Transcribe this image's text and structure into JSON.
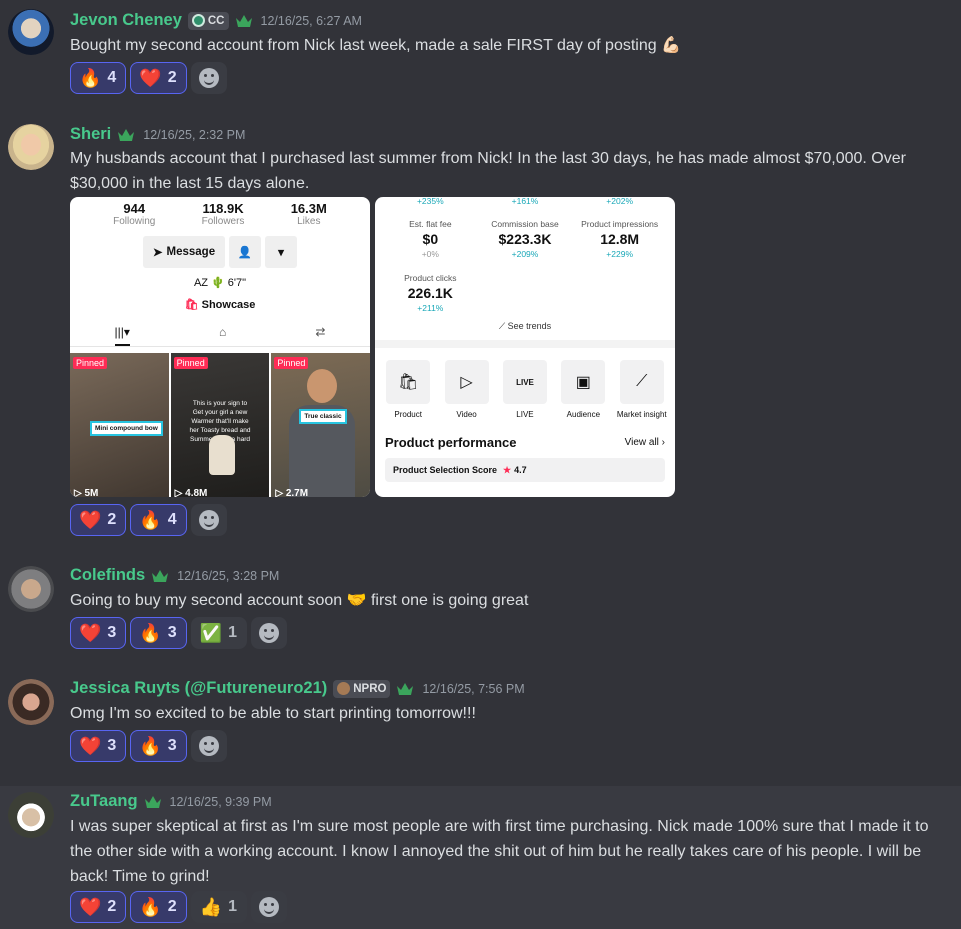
{
  "messages": [
    {
      "username": "Jevon Cheney",
      "tag": "CC",
      "timestamp": "12/16/25, 6:27 AM",
      "text": "Bought my second account from Nick last week, made a sale FIRST day of posting 💪🏻",
      "reactions": [
        {
          "emoji": "🔥",
          "count": "4",
          "mine": true
        },
        {
          "emoji": "❤️",
          "count": "2",
          "mine": true
        }
      ]
    },
    {
      "username": "Sheri",
      "timestamp": "12/16/25, 2:32 PM",
      "text": "My husbands account that I purchased last summer from Nick! In the last 30 days, he has made almost $70,000. Over $30,000 in the last 15 days alone.",
      "reactions": [
        {
          "emoji": "❤️",
          "count": "2",
          "mine": true
        },
        {
          "emoji": "🔥",
          "count": "4",
          "mine": true
        }
      ]
    },
    {
      "username": "Colefinds",
      "timestamp": "12/16/25, 3:28 PM",
      "text": "Going to buy my second account soon 🤝 first one is going great",
      "reactions": [
        {
          "emoji": "❤️",
          "count": "3",
          "mine": true
        },
        {
          "emoji": "🔥",
          "count": "3",
          "mine": true
        },
        {
          "emoji": "✅",
          "count": "1",
          "mine": false
        }
      ]
    },
    {
      "username": "Jessica Ruyts (@Futureneuro21)",
      "tag": "NPRO",
      "timestamp": "12/16/25, 7:56 PM",
      "text": "Omg I'm so excited to be able to start printing tomorrow!!!",
      "reactions": [
        {
          "emoji": "❤️",
          "count": "3",
          "mine": true
        },
        {
          "emoji": "🔥",
          "count": "3",
          "mine": true
        }
      ]
    },
    {
      "username": "ZuTaang",
      "timestamp": "12/16/25, 9:39 PM",
      "text": "I was super skeptical at first as I'm sure most people are with first time purchasing. Nick made 100% sure that I made it to the other side with a working account. I know I annoyed the shit out of him but he really takes care of his people. I will be back! Time to grind!",
      "reactions": [
        {
          "emoji": "❤️",
          "count": "2",
          "mine": true
        },
        {
          "emoji": "🔥",
          "count": "2",
          "mine": true
        },
        {
          "emoji": "👍",
          "count": "1",
          "mine": false
        }
      ]
    }
  ],
  "profile_shot": {
    "stats": [
      {
        "value": "944",
        "label": "Following"
      },
      {
        "value": "118.9K",
        "label": "Followers"
      },
      {
        "value": "16.3M",
        "label": "Likes"
      }
    ],
    "message_btn": "Message",
    "bio": "AZ 🌵 6'7\"",
    "showcase": "Showcase",
    "videos": [
      {
        "pinned": "Pinned",
        "views": "5M",
        "caption": "Mini compound bow",
        "overtext": "",
        "bg": "#5a5048"
      },
      {
        "pinned": "Pinned",
        "views": "4.8M",
        "caption": "",
        "overtext": "This is your sign to Get your girl a new Warmer that'll make her Toasty bread and Summer After a hard day",
        "bg": "#2e2c2a"
      },
      {
        "pinned": "Pinned",
        "views": "2.7M",
        "caption": "True classic",
        "overtext": "",
        "bg": "#6b5e4e"
      }
    ]
  },
  "analytics_shot": {
    "top_row": [
      {
        "pct": "+235%"
      },
      {
        "pct": "+161%"
      },
      {
        "pct": "+202%"
      }
    ],
    "metrics": [
      {
        "label": "Est. flat fee",
        "value": "$0",
        "pct": "+0%"
      },
      {
        "label": "Commission base",
        "value": "$223.3K",
        "pct": "+209%"
      },
      {
        "label": "Product impressions",
        "value": "12.8M",
        "pct": "+229%"
      },
      {
        "label": "Product clicks",
        "value": "226.1K",
        "pct": "+211%"
      }
    ],
    "see_trends": "See trends",
    "tools": [
      "Product",
      "Video",
      "LIVE",
      "Audience",
      "Market insight"
    ],
    "performance_title": "Product performance",
    "view_all": "View all",
    "selection_score_label": "Product Selection Score",
    "selection_score_value": "4.7"
  }
}
